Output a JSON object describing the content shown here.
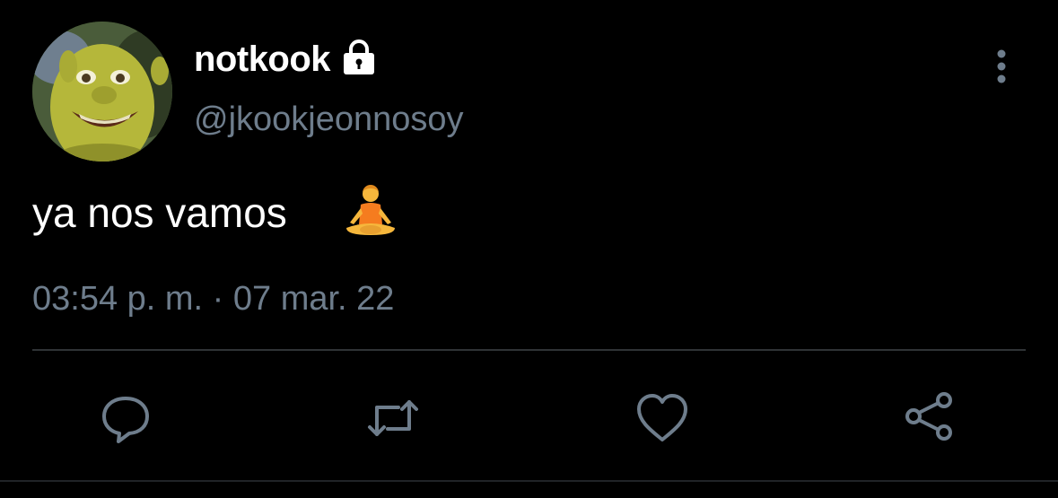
{
  "user": {
    "display_name": "notkook",
    "handle": "@jkookjeonnosoy",
    "protected_icon": "lock-icon",
    "avatar": "shrek-avatar"
  },
  "tweet": {
    "text": "ya nos vamos",
    "emoji": "person-in-lotus-position",
    "timestamp": "03:54 p. m. · 07 mar. 22"
  },
  "actions": [
    {
      "name": "reply",
      "icon": "speech-bubble-icon"
    },
    {
      "name": "retweet",
      "icon": "retweet-icon"
    },
    {
      "name": "like",
      "icon": "heart-icon"
    },
    {
      "name": "share",
      "icon": "share-icon"
    }
  ],
  "colors": {
    "background": "#000000",
    "primary_text": "#ffffff",
    "secondary_text": "#6e7d8c",
    "divider": "#2f3336",
    "icon": "#6e7d8c"
  }
}
